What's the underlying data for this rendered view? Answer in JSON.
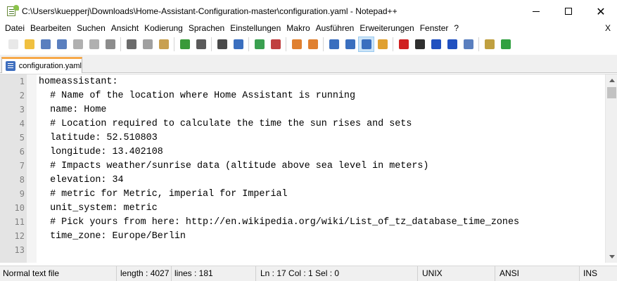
{
  "window": {
    "title": "C:\\Users\\kuepperj\\Downloads\\Home-Assistant-Configuration-master\\configuration.yaml - Notepad++",
    "min_label": "",
    "max_label": "",
    "close_label": "✕"
  },
  "menu": {
    "items": [
      "Datei",
      "Bearbeiten",
      "Suchen",
      "Ansicht",
      "Kodierung",
      "Sprachen",
      "Einstellungen",
      "Makro",
      "Ausführen",
      "Erweiterungen",
      "Fenster",
      "?"
    ],
    "close_label": "X"
  },
  "toolbar": {
    "icons": [
      {
        "name": "new-file-icon",
        "color": "#e8e8e8"
      },
      {
        "name": "open-file-icon",
        "color": "#f0c040"
      },
      {
        "name": "save-icon",
        "color": "#5a7fbf"
      },
      {
        "name": "save-all-icon",
        "color": "#5a7fbf"
      },
      {
        "name": "close-icon",
        "color": "#b0b0b0"
      },
      {
        "name": "close-all-icon",
        "color": "#b0b0b0"
      },
      {
        "name": "print-icon",
        "color": "#8c8c8c"
      },
      {
        "name": "cut-icon",
        "color": "#6b6b6b"
      },
      {
        "name": "copy-icon",
        "color": "#a0a0a0"
      },
      {
        "name": "paste-icon",
        "color": "#c8a050"
      },
      {
        "name": "undo-icon",
        "color": "#3a9a3a"
      },
      {
        "name": "redo-icon",
        "color": "#5a5a5a"
      },
      {
        "name": "find-icon",
        "color": "#4a4a4a"
      },
      {
        "name": "replace-icon",
        "color": "#3a6fbf"
      },
      {
        "name": "zoom-in-icon",
        "color": "#3aa050"
      },
      {
        "name": "zoom-out-icon",
        "color": "#c04040"
      },
      {
        "name": "sync-vertical-icon",
        "color": "#e08030"
      },
      {
        "name": "sync-horizontal-icon",
        "color": "#e08030"
      },
      {
        "name": "word-wrap-icon",
        "color": "#3a6fbf"
      },
      {
        "name": "show-all-chars-icon",
        "color": "#3a6fbf"
      },
      {
        "name": "indent-guide-icon",
        "color": "#3a6fbf"
      },
      {
        "name": "user-language-icon",
        "color": "#e0a030"
      },
      {
        "name": "record-macro-icon",
        "color": "#d02020"
      },
      {
        "name": "stop-record-icon",
        "color": "#303030"
      },
      {
        "name": "play-macro-icon",
        "color": "#2050c0"
      },
      {
        "name": "play-multiple-icon",
        "color": "#2050c0"
      },
      {
        "name": "save-macro-icon",
        "color": "#5a7fbf"
      },
      {
        "name": "plugin-icon",
        "color": "#c0a040"
      },
      {
        "name": "spell-check-icon",
        "color": "#30a040"
      }
    ]
  },
  "tab": {
    "label": "configuration.yaml"
  },
  "editor": {
    "lines": [
      {
        "n": "1",
        "text": "homeassistant:"
      },
      {
        "n": "2",
        "text": "  # Name of the location where Home Assistant is running"
      },
      {
        "n": "3",
        "text": "  name: Home"
      },
      {
        "n": "4",
        "text": "  # Location required to calculate the time the sun rises and sets"
      },
      {
        "n": "5",
        "text": "  latitude: 52.510803"
      },
      {
        "n": "6",
        "text": "  longitude: 13.402108"
      },
      {
        "n": "7",
        "text": "  # Impacts weather/sunrise data (altitude above sea level in meters)"
      },
      {
        "n": "8",
        "text": "  elevation: 34"
      },
      {
        "n": "9",
        "text": "  # metric for Metric, imperial for Imperial"
      },
      {
        "n": "10",
        "text": "  unit_system: metric"
      },
      {
        "n": "11",
        "text": "  # Pick yours from here: http://en.wikipedia.org/wiki/List_of_tz_database_time_zones"
      },
      {
        "n": "12",
        "text": "  time_zone: Europe/Berlin"
      },
      {
        "n": "13",
        "text": ""
      }
    ]
  },
  "status": {
    "file_type": "Normal text file",
    "length": "length : 4027",
    "lines": "lines : 181",
    "position": "Ln : 17    Col : 1    Sel : 0",
    "eol": "UNIX",
    "encoding": "ANSI",
    "mode": "INS"
  }
}
